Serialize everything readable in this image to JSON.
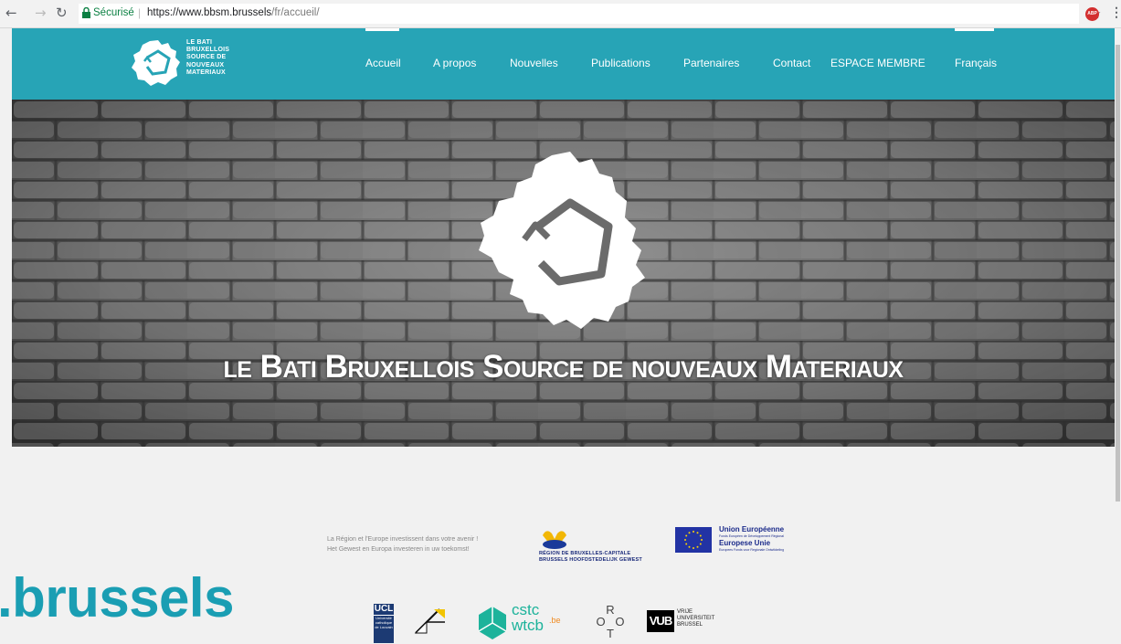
{
  "browser": {
    "secure_label": "Sécurisé",
    "url_domain": "https://www.bbsm.brussels",
    "url_path": "/fr/accueil/",
    "back_icon": "arrow-left-icon",
    "forward_icon": "arrow-right-icon",
    "reload_icon": "reload-icon",
    "star_icon": "star-icon",
    "abp_label": "ABP"
  },
  "header": {
    "logo_text": "LE BATI\nBRUXELLOIS\nSOURCE DE\nNOUVEAUX\nMATERIAUX",
    "nav": [
      "Accueil",
      "A propos",
      "Nouvelles",
      "Publications",
      "Partenaires",
      "Contact",
      "ESPACE MEMBRE",
      "Français"
    ],
    "active_nav": "Accueil",
    "background_color": "#27a4b6"
  },
  "hero": {
    "title": "le Bati Bruxellois Source de nouveaux Materiaux"
  },
  "partners": {
    "funding_text": "La Région et l'Europe investissent dans votre avenir !\nHet Gewest en Europa investeren in uw toekomst!",
    "region_text": "RÉGION DE BRUXELLES-CAPITALE\nBRUSSELS HOOFDSTEDELIJK GEWEST",
    "eu_title_fr": "Union Européenne",
    "eu_subtitle_fr": "Fonds Européen de Développement Régional",
    "eu_title_nl": "Europese Unie",
    "eu_subtitle_nl": "Europees Fonds voor Regionale Ontwikkeling",
    "brussels_text": ".brussels",
    "ucl_abbr": "UCL",
    "ucl_name": "Université\ncatholique\nde Louvain",
    "cstc_text": "cstc\nwtcb",
    "cstc_suffix": ".be",
    "crt_text": "R\nO   O\nT",
    "vub_abbr": "VUB",
    "vub_name": "VRIJE\nUNIVERSITEIT\nBRUSSEL"
  }
}
